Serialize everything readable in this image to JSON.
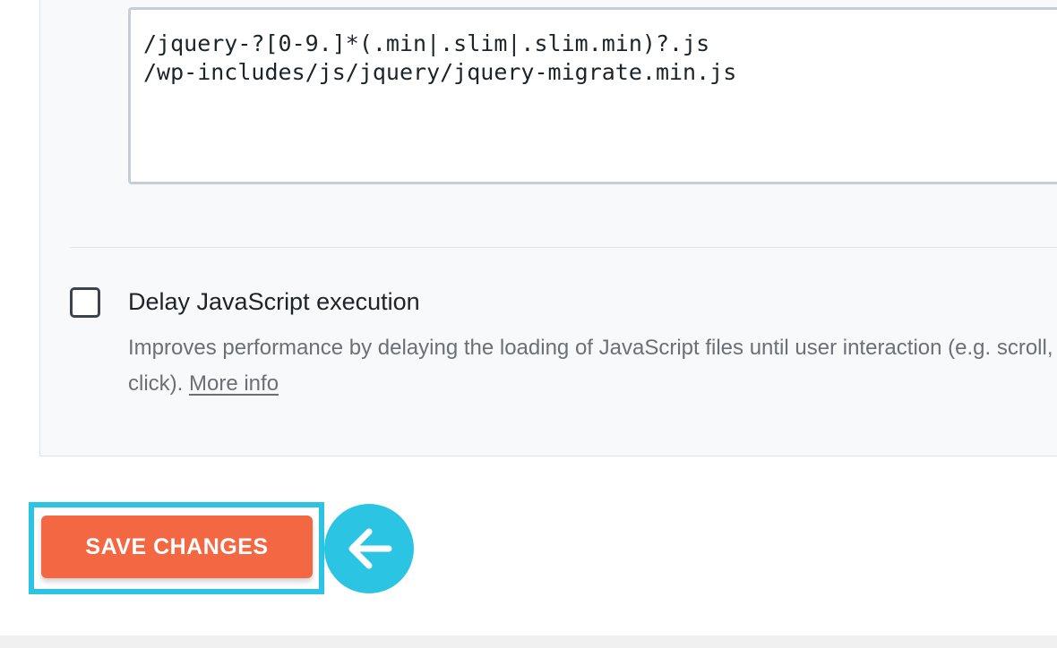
{
  "exclusions": {
    "value": "/jquery-?[0-9.]*(.min|.slim|.slim.min)?.js\n/wp-includes/js/jquery/jquery-migrate.min.js"
  },
  "delay_js": {
    "label": "Delay JavaScript execution",
    "checked": false,
    "description": "Improves performance by delaying the loading of JavaScript files until user interaction (e.g. scroll,",
    "description_end": "click). ",
    "more_info_label": "More info"
  },
  "actions": {
    "save_label": "SAVE CHANGES"
  },
  "annotation": {
    "icon": "arrow-left-icon",
    "color": "#2cc4e3"
  },
  "colors": {
    "save_button": "#f36843",
    "highlight": "#2cc4e3"
  }
}
